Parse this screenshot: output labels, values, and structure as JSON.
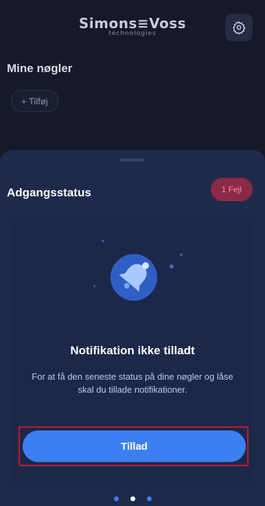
{
  "header": {
    "brand_name": "Simons≡Voss",
    "brand_sub": "technologies",
    "settings_icon": "gear-icon"
  },
  "keys_section": {
    "title": "Mine nøgler",
    "add_label": "+ Tilføj"
  },
  "sheet": {
    "title": "Adgangsstatus",
    "error_badge": "1 Fejl",
    "notice": {
      "icon": "bell-icon",
      "title": "Notifikation ikke tilladt",
      "body": "For at få den seneste status på dine nøgler og låse skal du tillade notifikationer."
    },
    "allow_button": "Tillad",
    "pager": {
      "pages": 3,
      "active_index": 1
    }
  },
  "colors": {
    "background": "#15192a",
    "sheet": "#1e2a4b",
    "accent": "#3d7ff2",
    "error_badge_bg": "#8a2a44",
    "error_badge_text": "#ff8fa5",
    "highlight": "#c2182e"
  }
}
